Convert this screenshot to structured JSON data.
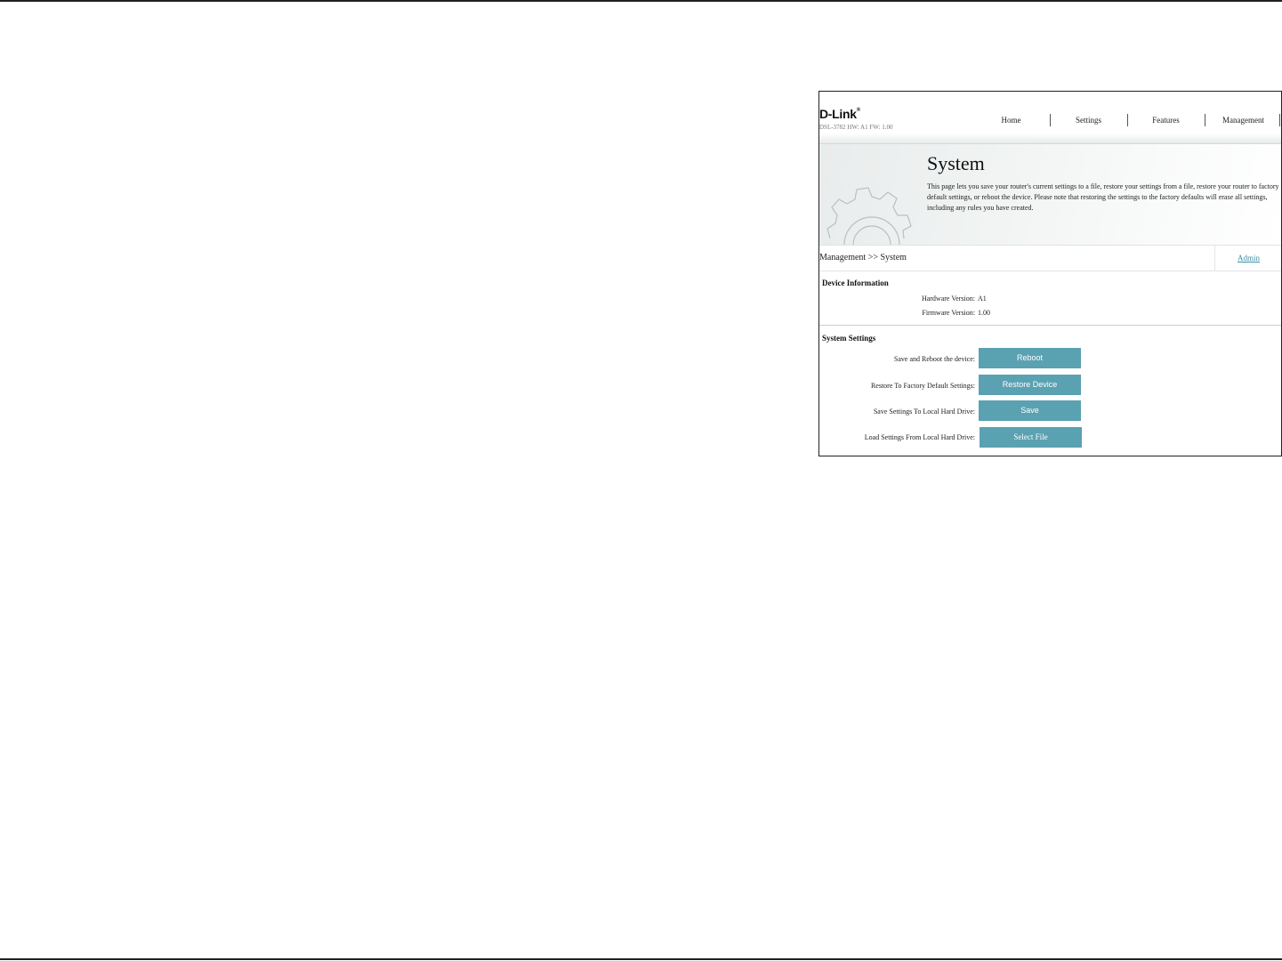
{
  "header": {
    "brand": "D-Link",
    "trademark": "®",
    "model_info": "DSL-3782  HW: A1  FW: 1.00",
    "nav": [
      {
        "label": "Home"
      },
      {
        "label": "Settings"
      },
      {
        "label": "Features"
      },
      {
        "label": "Management"
      }
    ]
  },
  "banner": {
    "title": "System",
    "description": "This page lets you save your router's current settings to a file, restore your settings from a file, restore your router to factory default settings, or reboot the device. Please note that restoring the settings to the factory defaults will erase all settings, including any rules you have created.",
    "icon": "gear-icon"
  },
  "breadcrumb": {
    "text": "Management >> System",
    "admin_link": "Admin"
  },
  "device_information": {
    "title": "Device Information",
    "rows": [
      {
        "label": "Hardware Version:",
        "value": "A1"
      },
      {
        "label": "Firmware Version:",
        "value": "1.00"
      }
    ]
  },
  "system_settings": {
    "title": "System Settings",
    "rows": [
      {
        "label": "Save and Reboot the device:",
        "button": "Reboot"
      },
      {
        "label": "Restore To Factory Default Settings:",
        "button": "Restore Device"
      },
      {
        "label": "Save Settings To Local Hard Drive:",
        "button": "Save"
      },
      {
        "label": "Load Settings From Local Hard Drive:",
        "button": "Select File"
      }
    ]
  },
  "colors": {
    "button": "#5aa1b2",
    "link": "#3a8fa8",
    "rule": "#231f20"
  }
}
